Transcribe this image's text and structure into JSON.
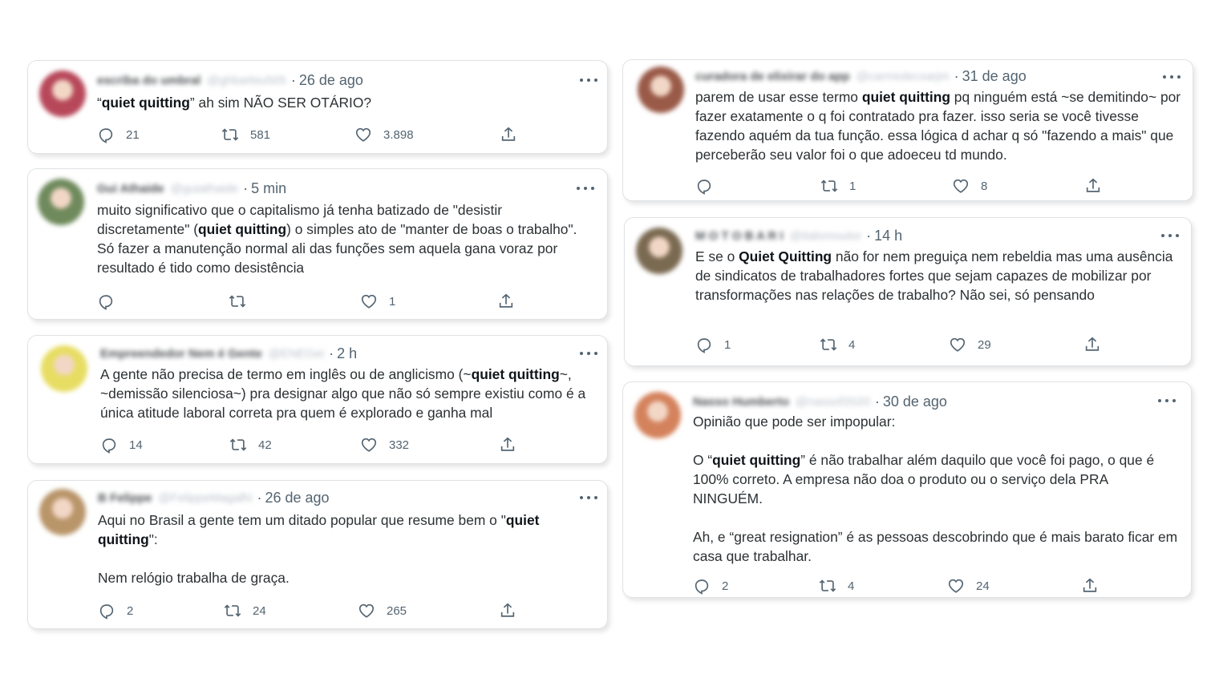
{
  "tweets": [
    {
      "author_name": "escriba do umbral",
      "author_handle": "@ghbarbiu505",
      "time": "26 de ago",
      "text_parts": [
        {
          "t": "“"
        },
        {
          "t": "quiet quitting",
          "b": true
        },
        {
          "t": "” ah sim NÃO SER OTÁRIO?"
        }
      ],
      "counts": {
        "reply": "21",
        "retweet": "581",
        "like": "3.898"
      },
      "avatar_color": "#b7485a"
    },
    {
      "author_name": "Gui Athaide",
      "author_handle": "@guiathaide",
      "time": "5 min",
      "text_parts": [
        {
          "t": "muito significativo que o capitalismo já tenha batizado de \"desistir discretamente\" ("
        },
        {
          "t": "quiet quitting",
          "b": true
        },
        {
          "t": ") o simples ato de \"manter de boas o trabalho\". Só fazer a manutenção normal ali das funções sem aquela gana voraz por resultado é tido como desistência"
        }
      ],
      "counts": {
        "reply": "",
        "retweet": "",
        "like": "1"
      },
      "avatar_color": "#6f8a5c"
    },
    {
      "author_name": "Empreendedor Nem é Gente",
      "author_handle": "@ENEGei",
      "time": "2 h",
      "text_parts": [
        {
          "t": "A gente não precisa de termo em inglês ou de anglicismo (~"
        },
        {
          "t": "quiet quitting",
          "b": true
        },
        {
          "t": "~, ~demissão silenciosa~) pra designar algo que não só sempre existiu como é a única atitude laboral correta pra quem é explorado e ganha mal"
        }
      ],
      "counts": {
        "reply": "14",
        "retweet": "42",
        "like": "332"
      },
      "avatar_color": "#e7dd63"
    },
    {
      "author_name": "B Felippe",
      "author_handle": "@FelippeMagalhi",
      "time": "26 de ago",
      "text_parts": [
        {
          "t": "Aqui no Brasil a gente tem um ditado popular que resume bem o \""
        },
        {
          "t": "quiet quitting",
          "b": true
        },
        {
          "t": "\":\n\nNem relógio trabalha de graça."
        }
      ],
      "counts": {
        "reply": "2",
        "retweet": "24",
        "like": "265"
      },
      "avatar_color": "#b9956a"
    },
    {
      "author_name": "curadora de elixirar do app",
      "author_handle": "@carmiolecxarjm",
      "time": "31 de ago",
      "text_parts": [
        {
          "t": "parem de usar esse termo "
        },
        {
          "t": "quiet quitting",
          "b": true
        },
        {
          "t": " pq ninguém está ~se demitindo~ por fazer exatamente o q foi contratado pra fazer. isso seria se você tivesse fazendo aquém da tua função. essa lógica d achar q só \"fazendo a mais\" que perceberão seu valor foi o que adoeceu td mundo."
        }
      ],
      "counts": {
        "reply": "",
        "retweet": "1",
        "like": "8"
      },
      "avatar_color": "#9a5a48"
    },
    {
      "author_name": "M O T O B A R I",
      "author_handle": "@italomoutor",
      "time": "14 h",
      "text_parts": [
        {
          "t": "E se o "
        },
        {
          "t": "Quiet Quitting",
          "b": true
        },
        {
          "t": " não for nem preguiça nem rebeldia mas uma ausência de sindicatos de trabalhadores fortes que sejam capazes de mobilizar por transformações nas relações de trabalho? Não sei, só pensando"
        }
      ],
      "counts": {
        "reply": "1",
        "retweet": "4",
        "like": "29"
      },
      "avatar_color": "#7b6a52"
    },
    {
      "author_name": "Nasso Humberto",
      "author_handle": "@nassof2020",
      "time": "30 de ago",
      "text_parts": [
        {
          "t": "Opinião que pode ser impopular:\n\nO  “"
        },
        {
          "t": "quiet quitting",
          "b": true
        },
        {
          "t": "” é não trabalhar além daquilo que você foi pago, o que é 100% correto. A empresa não doa o produto ou o serviço dela PRA NINGUÉM.\n\nAh, e “great resignation” é as pessoas descobrindo que é mais barato ficar em casa que trabalhar."
        }
      ],
      "counts": {
        "reply": "2",
        "retweet": "4",
        "like": "24"
      },
      "avatar_color": "#d4825c"
    }
  ]
}
